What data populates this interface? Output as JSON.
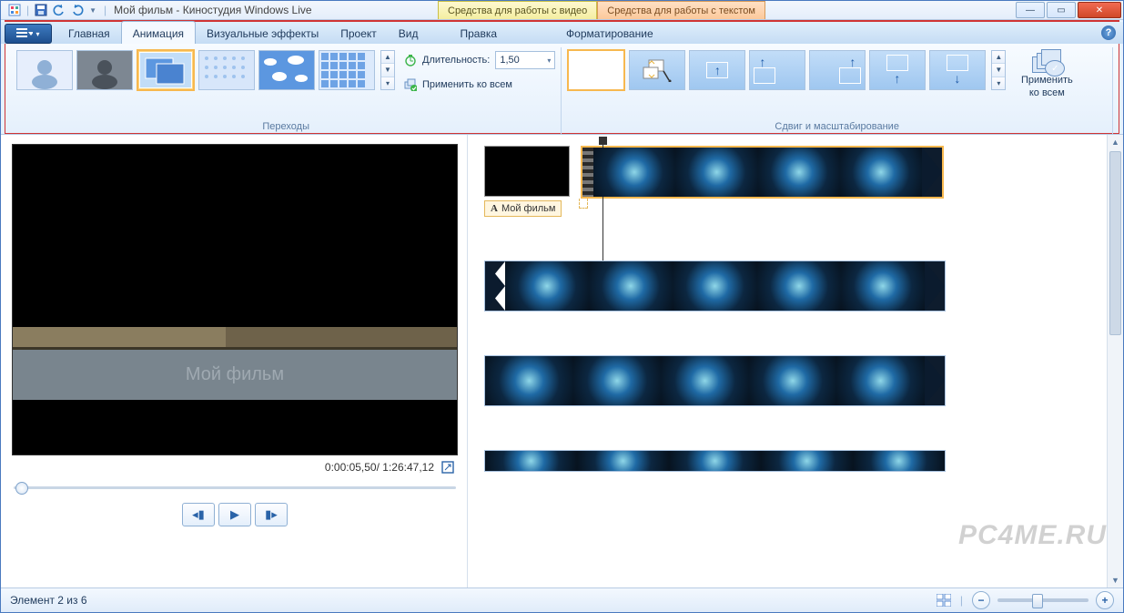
{
  "titlebar": {
    "app_title": "Мой фильм - Киностудия Windows Live",
    "tool_tab_video": "Средства для работы с видео",
    "tool_tab_text": "Средства для работы с текстом"
  },
  "ribbon": {
    "tabs": {
      "home": "Главная",
      "animation": "Анимация",
      "visual_effects": "Визуальные эффекты",
      "project": "Проект",
      "view": "Вид",
      "edit": "Правка",
      "formatting": "Форматирование"
    },
    "groups": {
      "transitions": "Переходы",
      "pan_zoom": "Сдвиг и масштабирование"
    },
    "duration_label": "Длительность:",
    "duration_value": "1,50",
    "apply_all": "Применить ко всем",
    "apply_all_big_line1": "Применить",
    "apply_all_big_line2": "ко всем"
  },
  "preview": {
    "overlay_title": "Мой фильм",
    "time_current": "0:00:05,50",
    "time_total": "1:26:47,12"
  },
  "timeline": {
    "title_caption": "Мой фильм"
  },
  "statusbar": {
    "status": "Элемент 2 из 6"
  },
  "watermark": "PC4ME.RU",
  "icons": {
    "title_A": "A"
  }
}
